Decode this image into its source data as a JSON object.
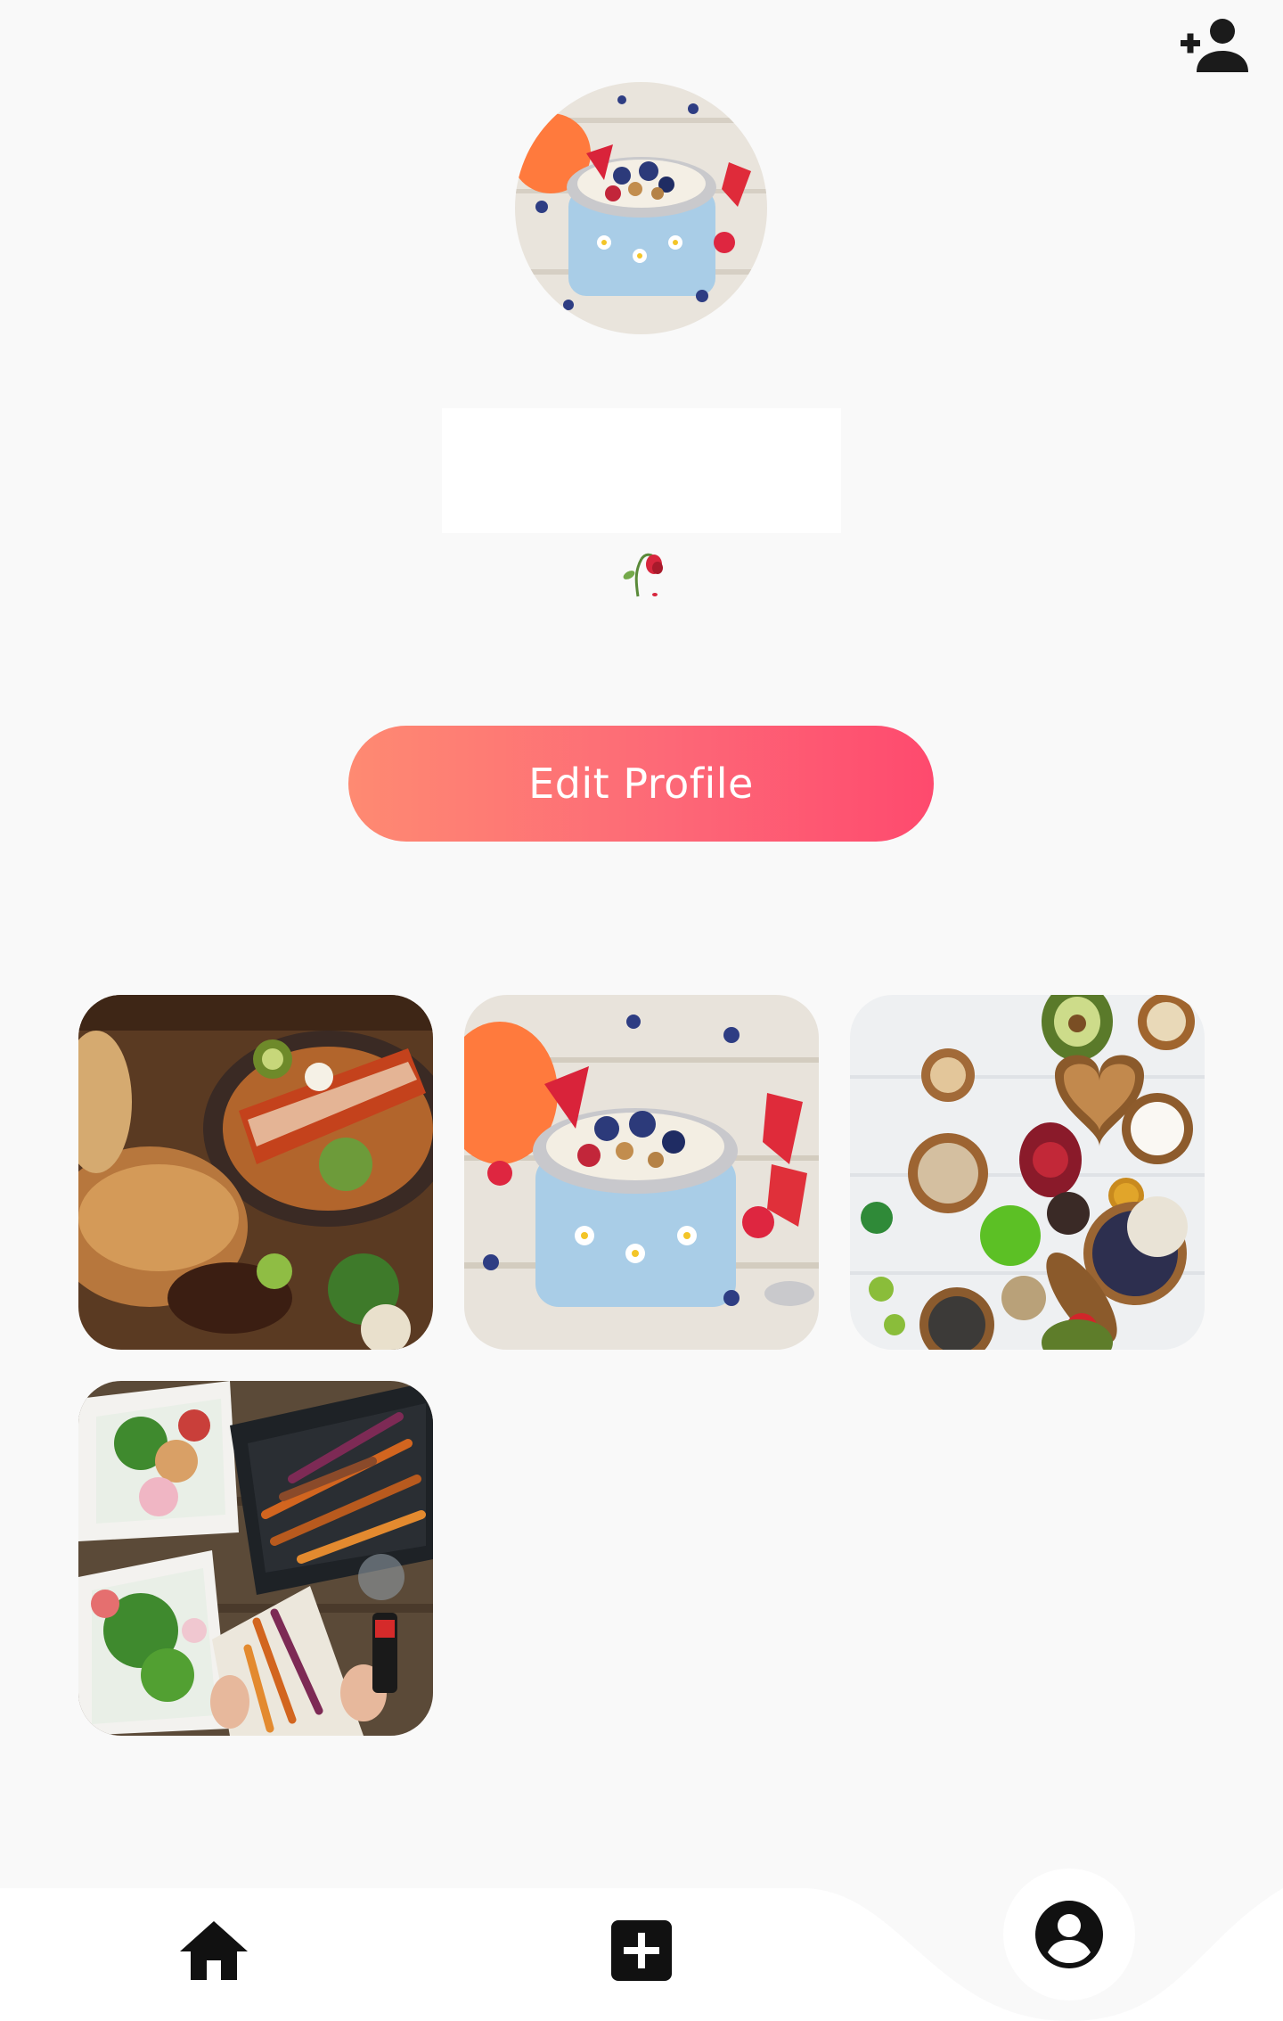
{
  "header": {
    "add_user_icon": "person-add-icon"
  },
  "profile": {
    "avatar_icon": "profile-photo",
    "name": "",
    "bio_emoji": "🥀",
    "edit_label": "Edit Profile",
    "edit_gradient": [
      "#fe8a72",
      "#fe4a6e"
    ]
  },
  "posts": [
    {
      "id": "post-1",
      "subject": "enchiladas-platter"
    },
    {
      "id": "post-2",
      "subject": "yogurt-berry-bowl"
    },
    {
      "id": "post-3",
      "subject": "nuts-seeds-spread"
    },
    {
      "id": "post-4",
      "subject": "roasted-carrots-salad"
    }
  ],
  "bottom_nav": {
    "items": [
      {
        "icon": "home-icon"
      },
      {
        "icon": "add-post-icon"
      },
      {
        "icon": "account-circle-icon",
        "active": true
      }
    ]
  }
}
